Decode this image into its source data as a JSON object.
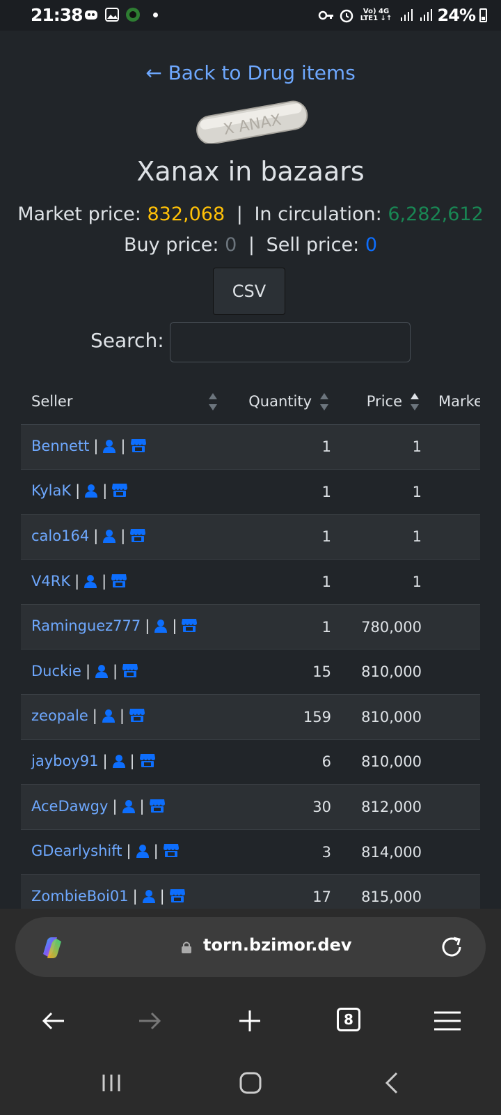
{
  "status_bar": {
    "time": "21:38",
    "network": "Vo) 4G LTE1",
    "battery": "24%"
  },
  "page": {
    "back_link": "← Back to Drug items",
    "title": "Xanax in bazaars",
    "pill_text": "X ANAX",
    "market_price_label": "Market price:",
    "market_price": "832,068",
    "circulation_label": "In circulation:",
    "circulation": "6,282,612",
    "buy_price_label": "Buy price:",
    "buy_price": "0",
    "sell_price_label": "Sell price:",
    "sell_price": "0",
    "csv_label": "CSV",
    "search_label": "Search:",
    "search_value": ""
  },
  "table": {
    "headers": {
      "seller": "Seller",
      "quantity": "Quantity",
      "price": "Price",
      "market": "Marke"
    },
    "rows": [
      {
        "seller": "Bennett",
        "quantity": "1",
        "price": "1"
      },
      {
        "seller": "KylaK",
        "quantity": "1",
        "price": "1"
      },
      {
        "seller": "calo164",
        "quantity": "1",
        "price": "1"
      },
      {
        "seller": "V4RK",
        "quantity": "1",
        "price": "1"
      },
      {
        "seller": "Raminguez777",
        "quantity": "1",
        "price": "780,000"
      },
      {
        "seller": "Duckie",
        "quantity": "15",
        "price": "810,000"
      },
      {
        "seller": "zeopale",
        "quantity": "159",
        "price": "810,000"
      },
      {
        "seller": "jayboy91",
        "quantity": "6",
        "price": "810,000"
      },
      {
        "seller": "AceDawgy",
        "quantity": "30",
        "price": "812,000"
      },
      {
        "seller": "GDearlyshift",
        "quantity": "3",
        "price": "814,000"
      },
      {
        "seller": "ZombieBoi01",
        "quantity": "17",
        "price": "815,000"
      }
    ]
  },
  "browser": {
    "url": "torn.bzimor.dev",
    "tab_count": "8"
  },
  "colors": {
    "link": "#6ea8fe",
    "accent_blue": "#0d6efd",
    "yellow": "#ffc107",
    "green": "#198754",
    "bg": "#212529"
  }
}
